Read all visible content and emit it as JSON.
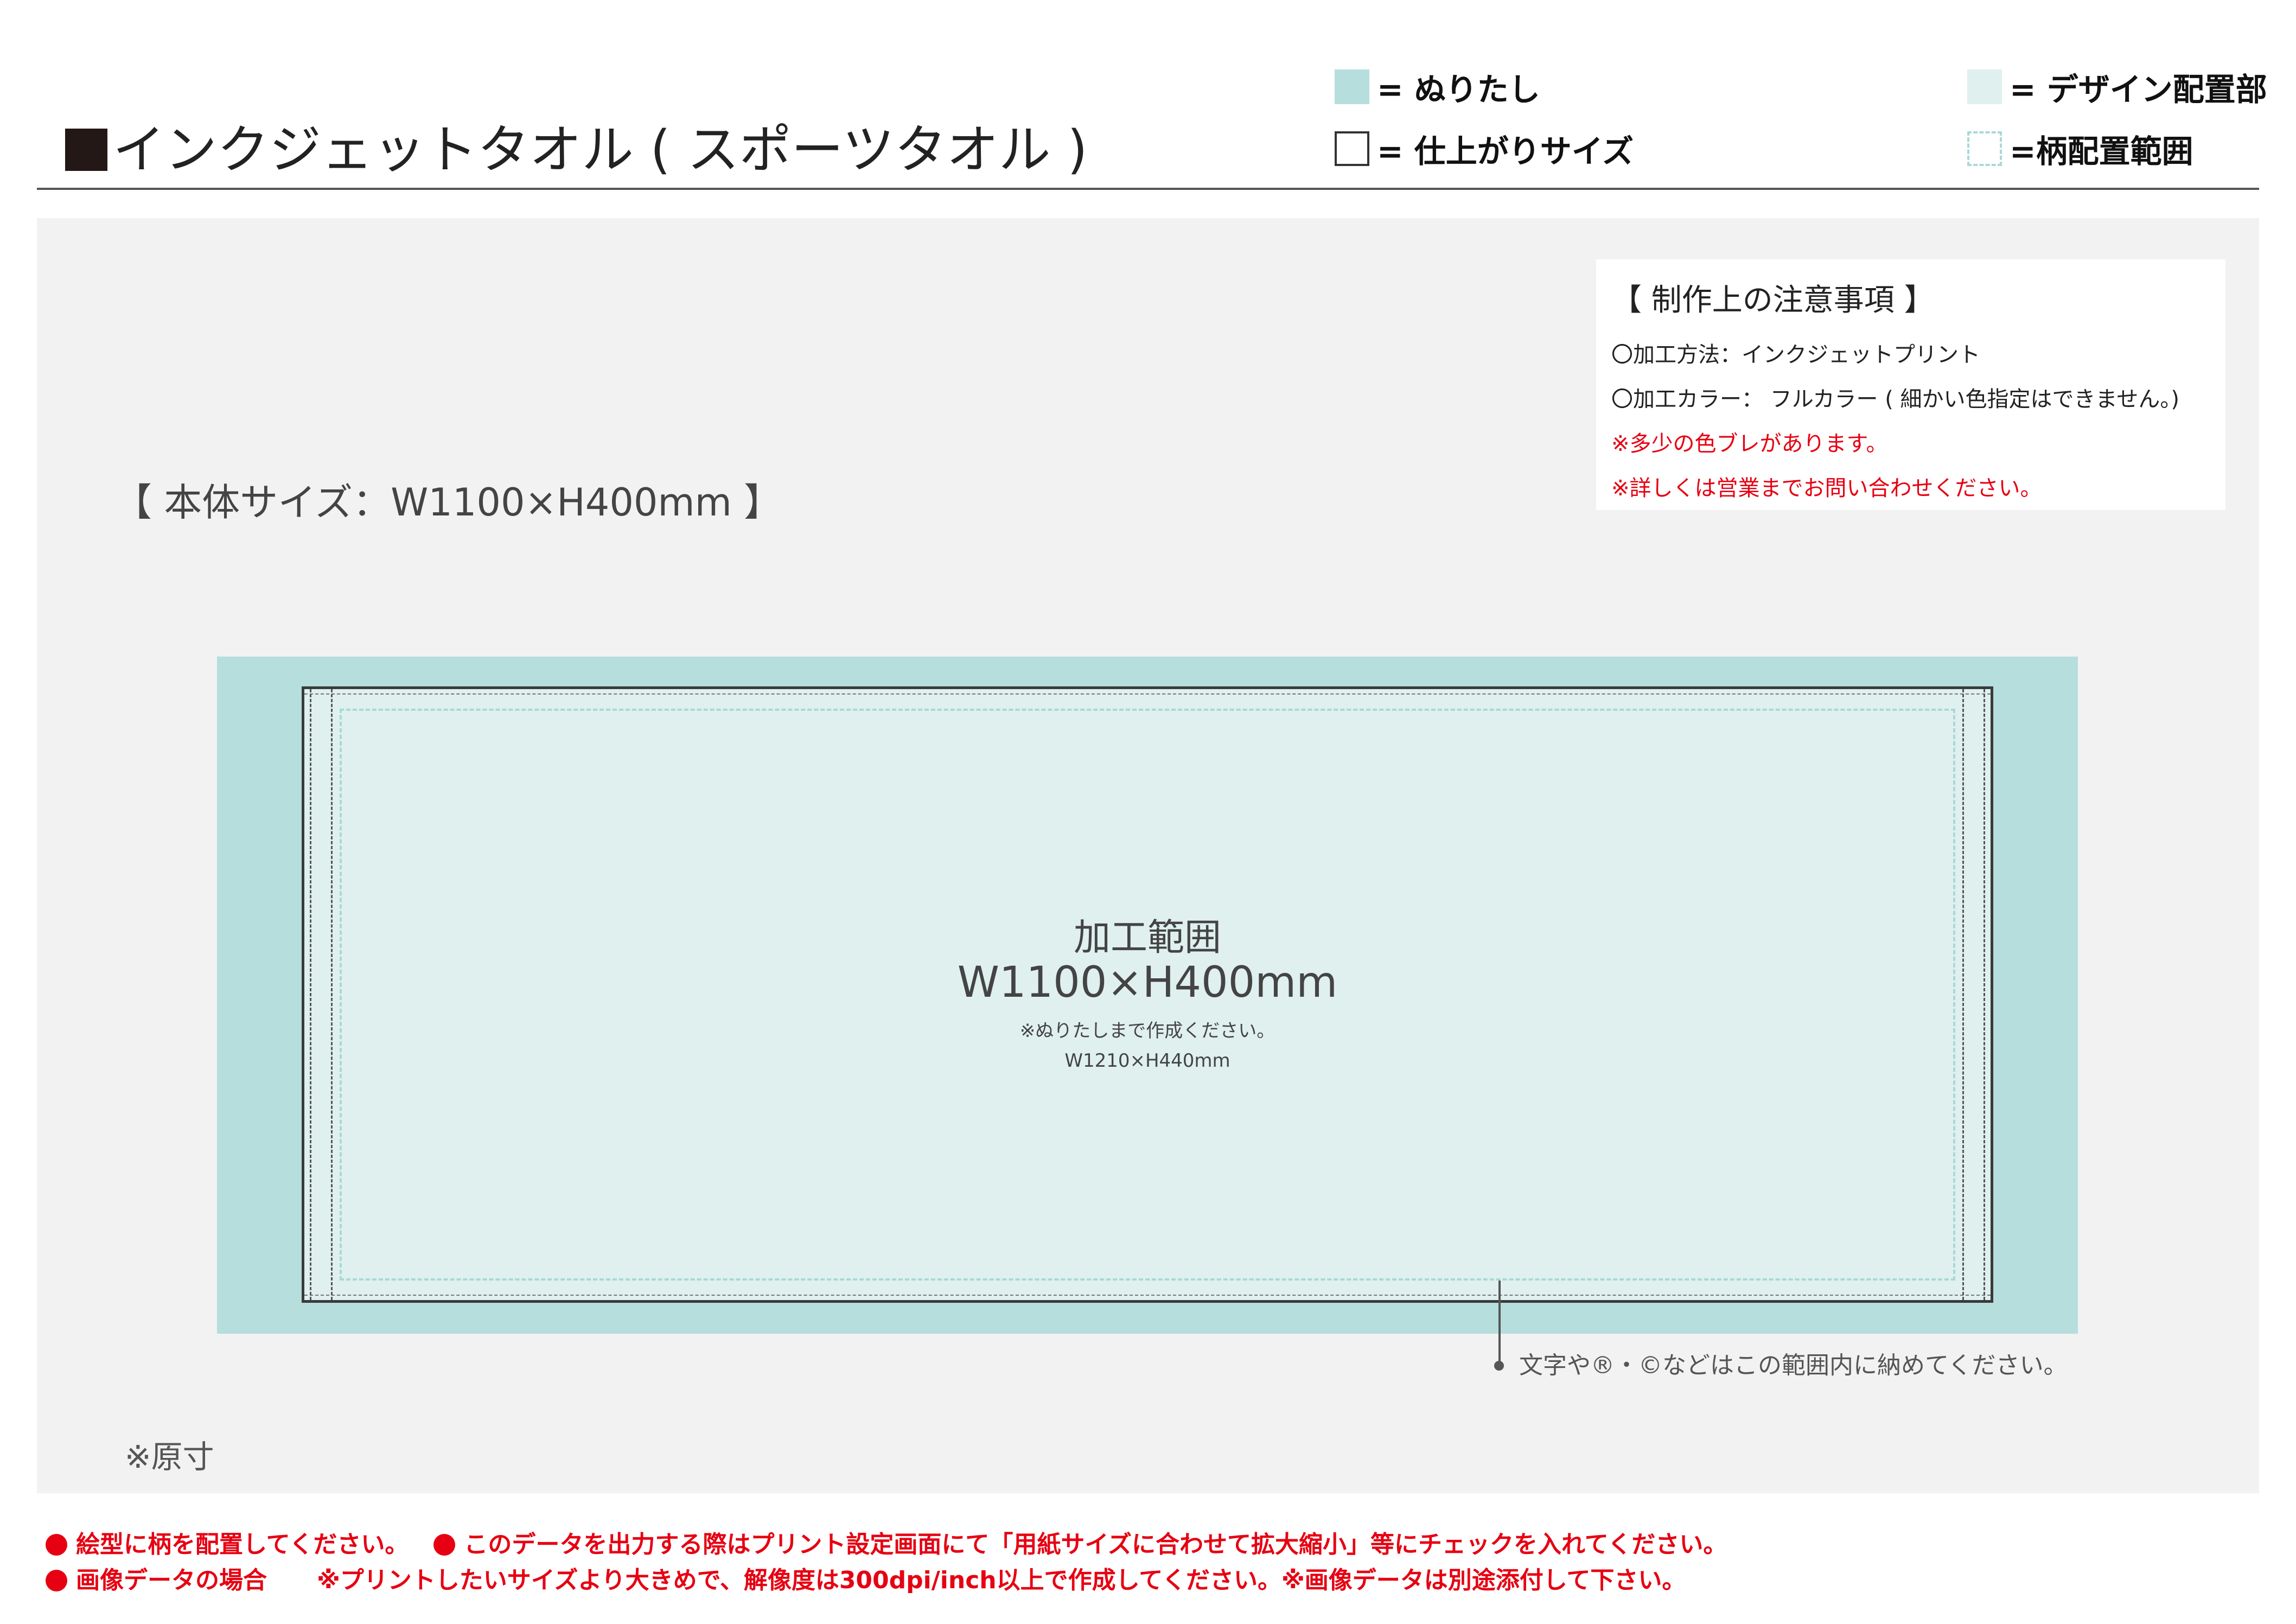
{
  "header": {
    "title": "インクジェットタオル ( スポーツタオル )"
  },
  "legend": {
    "bleed": "= ぬりたし",
    "trim": "= 仕上がりサイズ",
    "design": "= デザイン配置部",
    "pattern": "=柄配置範囲"
  },
  "colors": {
    "bleed": "#b5dedd",
    "design": "#dff0ee",
    "warning": "#e60012",
    "panel": "#f2f2f2"
  },
  "notes": {
    "title": "【 制作上の注意事項 】",
    "method": "〇加工方法：インクジェットプリント",
    "color": "〇加工カラー： フルカラー ( 細かい色指定はできません。)",
    "warn1": "※多少の色ブレがあります。",
    "warn2": "※詳しくは営業までお問い合わせください。"
  },
  "body_size": "【 本体サイズ：W1100×H400mm 】",
  "template": {
    "area_label": "加工範囲",
    "area_size": "W1100×H400mm",
    "bleed_note": "※ぬりたしまで作成ください。",
    "bleed_size": "W1210×H440mm",
    "leader_text": "文字や®・©などはこの範囲内に納めてください。"
  },
  "actual_size": "※原寸",
  "footer": {
    "line1a": "絵型に柄を配置してください。",
    "line1b": "このデータを出力する際はプリント設定画面にて「用紙サイズに合わせて拡大縮小」等にチェックを入れてください。",
    "line2a": "画像データの場合",
    "line2b": "※プリントしたいサイズより大きめで、解像度は300dpi/inch以上で作成してください。※画像データは別途添付して下さい。"
  }
}
